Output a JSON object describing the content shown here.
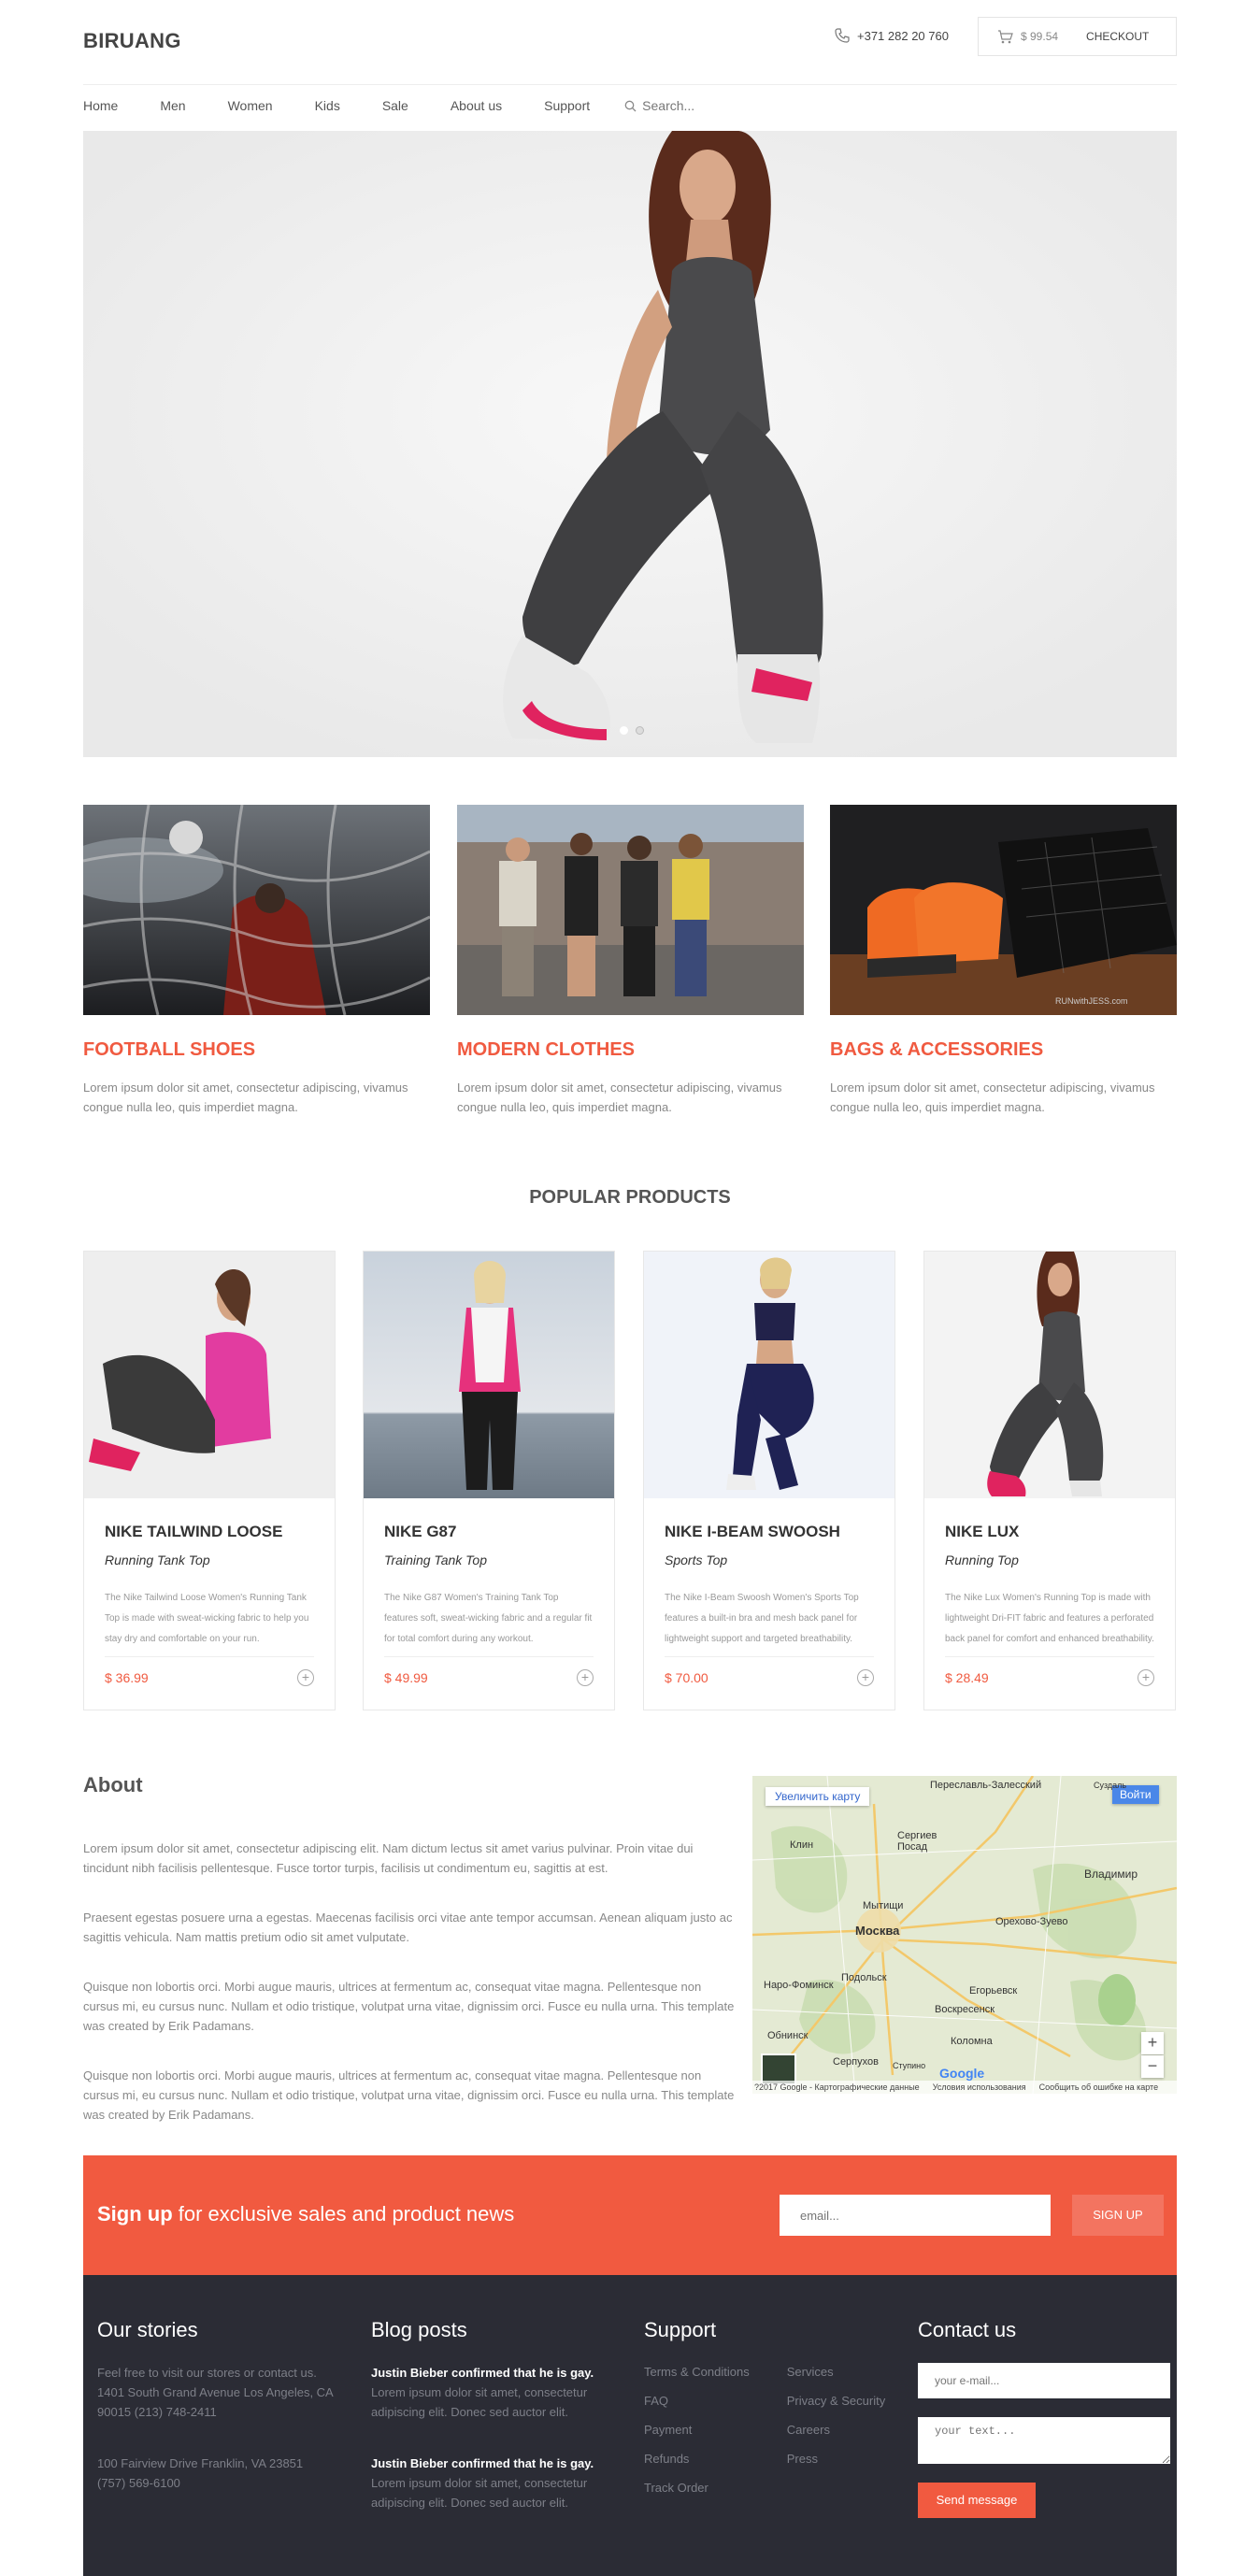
{
  "header": {
    "logo": "BIRUANG",
    "phone": "+371 282 20 760",
    "cart_total": "$ 99.54",
    "checkout_label": "CHECKOUT"
  },
  "nav": {
    "items": [
      "Home",
      "Men",
      "Women",
      "Kids",
      "Sale",
      "About us",
      "Support"
    ],
    "search_placeholder": "Search..."
  },
  "hero": {
    "slides": 2,
    "active_slide": 1
  },
  "categories": [
    {
      "title": "FOOTBALL SHOES",
      "desc": "Lorem ipsum dolor sit amet, consectetur adipiscing, vivamus congue nulla leo, quis imperdiet magna."
    },
    {
      "title": "MODERN CLOTHES",
      "desc": "Lorem ipsum dolor sit amet, consectetur adipiscing, vivamus congue nulla leo, quis imperdiet magna."
    },
    {
      "title": "BAGS & ACCESSORIES",
      "desc": "Lorem ipsum dolor sit amet, consectetur adipiscing, vivamus congue nulla leo, quis imperdiet magna.",
      "watermark": "RUNwithJESS.com"
    }
  ],
  "popular": {
    "title": "POPULAR PRODUCTS",
    "products": [
      {
        "name": "NIKE TAILWIND LOOSE",
        "type": "Running Tank Top",
        "desc": "The Nike Tailwind Loose Women's Running Tank Top is made with sweat-wicking fabric to help you stay dry and comfortable on your run.",
        "price": "$ 36.99"
      },
      {
        "name": "NIKE G87",
        "type": "Training Tank Top",
        "desc": "The Nike G87 Women's Training Tank Top features soft, sweat-wicking fabric and a regular fit for total comfort during any workout.",
        "price": "$ 49.99"
      },
      {
        "name": "NIKE I-BEAM SWOOSH",
        "type": "Sports Top",
        "desc": "The Nike I-Beam Swoosh Women's Sports Top features a built-in bra and mesh back panel for lightweight support and targeted breathability.",
        "price": "$ 70.00"
      },
      {
        "name": "NIKE LUX",
        "type": "Running Top",
        "desc": "The Nike Lux Women's Running Top is made with lightweight Dri-FIT fabric and features a perforated back panel for comfort and enhanced breathability.",
        "price": "$ 28.49"
      }
    ]
  },
  "about": {
    "title": "About",
    "paragraphs": [
      "Lorem ipsum dolor sit amet, consectetur adipiscing elit. Nam dictum lectus sit amet varius pulvinar. Proin vitae dui tincidunt nibh facilisis pellentesque. Fusce tortor turpis, facilisis ut condimentum eu, sagittis at est.",
      "Praesent egestas posuere urna a egestas. Maecenas facilisis orci vitae ante tempor accumsan. Aenean aliquam justo ac sagittis vehicula. Nam mattis pretium odio sit amet vulputate.",
      "Quisque non lobortis orci. Morbi augue mauris, ultrices at fermentum ac, consequat vitae magna. Pellentesque non cursus mi, eu cursus nunc. Nullam et odio tristique, volutpat urna vitae, dignissim orci. Fusce eu nulla urna. This template was created by Erik Padamans.",
      "Quisque non lobortis orci. Morbi augue mauris, ultrices at fermentum ac, consequat vitae magna. Pellentesque non cursus mi, eu cursus nunc. Nullam et odio tristique, volutpat urna vitae, dignissim orci. Fusce eu nulla urna. This template was created by Erik Padamans."
    ]
  },
  "map": {
    "enlarge_label": "Увеличить карту",
    "signin_label": "Войти",
    "cities": [
      "Переславль-Залесский",
      "Клин",
      "Сергиев Посад",
      "Владимир",
      "Мытищи",
      "Москва",
      "Орехово-Зуево",
      "Наро-Фоминск",
      "Подольск",
      "Егорьевск",
      "Обнинск",
      "Воскресенск",
      "Коломна",
      "Серпухов",
      "Ступино",
      "Суздаль"
    ],
    "footer": [
      "?2017 Google - Картографические данные",
      "Условия использования",
      "Сообщить об ошибке на карте"
    ],
    "logo": "Google"
  },
  "signup": {
    "bold": "Sign up",
    "rest": " for exclusive sales and product news",
    "placeholder": "email...",
    "button": "SIGN UP"
  },
  "footer": {
    "stories": {
      "title": "Our stories",
      "intro": "Feel free to visit our stores or contact us.",
      "addr1": "1401 South Grand Avenue Los Angeles, CA 90015 (213) 748-2411",
      "addr2": "100 Fairview Drive Franklin, VA 23851 (757) 569-6100"
    },
    "blog": {
      "title": "Blog posts",
      "posts": [
        {
          "title": "Justin Bieber confirmed that he is gay.",
          "text": "Lorem ipsum dolor sit amet, consectetur adipiscing elit. Donec sed auctor elit."
        },
        {
          "title": "Justin Bieber confirmed that he is gay.",
          "text": "Lorem ipsum dolor sit amet, consectetur adipiscing elit. Donec sed auctor elit."
        }
      ]
    },
    "support": {
      "title": "Support",
      "col1": [
        "Terms & Conditions",
        "FAQ",
        "Payment",
        "Refunds",
        "Track Order"
      ],
      "col2": [
        "Services",
        "Privacy & Security",
        "Careers",
        "Press"
      ]
    },
    "contact": {
      "title": "Contact us",
      "email_placeholder": "your e-mail...",
      "text_placeholder": "your text...",
      "send": "Send message"
    }
  },
  "colors": {
    "accent": "#f15a40",
    "footer_bg": "#2b2c35"
  }
}
